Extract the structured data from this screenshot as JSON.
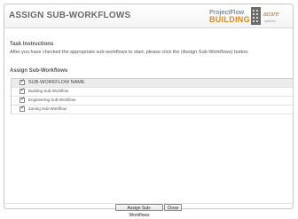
{
  "header": {
    "title": "ASSIGN SUB-WORKFLOWS",
    "logo": {
      "product_line1": "ProjectFlow",
      "product_line2": "BUILDING",
      "company": "acore",
      "company_sub": "systems"
    }
  },
  "instructions": {
    "title": "Task Instructions",
    "text": "After you have checked the appropriate sub-workflows to start, please click the (Assign Sub-Workflows) button."
  },
  "assign": {
    "title": "Assign Sub-Workflows",
    "header_label": "SUB-WORKFLOW NAME",
    "items": [
      {
        "label": "Building Sub-Workflow",
        "checked": true
      },
      {
        "label": "Engineering Sub-Workflow",
        "checked": true
      },
      {
        "label": "Zoning Sub-Workflow",
        "checked": true
      }
    ]
  },
  "footer": {
    "assign_button": "Assign Sub-Workflows",
    "close_button": "Close"
  },
  "colors": {
    "accent": "#e08a16",
    "logo_text": "#5b6a78",
    "header_text": "#6b6b6b"
  }
}
